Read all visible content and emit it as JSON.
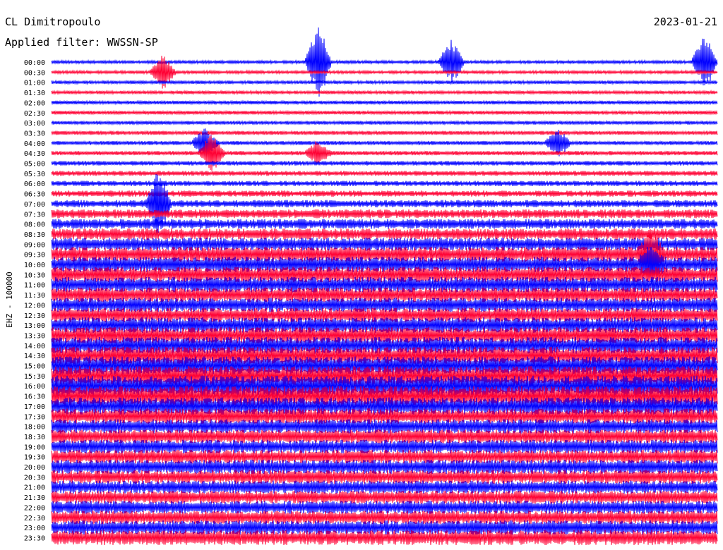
{
  "header": {
    "station": "CL Dimitropoulo",
    "filter": "Applied filter: WWSSN-SP",
    "date": "2023-01-21",
    "channel_label": "EHZ - 100000"
  },
  "chart_data": {
    "type": "line",
    "title": "CL Dimitropoulo",
    "subtitle": "Applied filter: WWSSN-SP",
    "date": "2023-01-21",
    "ylabel": "EHZ - 100000",
    "row_labels": [
      "00:00",
      "00:30",
      "01:00",
      "01:30",
      "02:00",
      "02:30",
      "03:00",
      "03:30",
      "04:00",
      "04:30",
      "05:00",
      "05:30",
      "06:00",
      "06:30",
      "07:00",
      "07:30",
      "08:00",
      "08:30",
      "09:00",
      "09:30",
      "10:00",
      "10:30",
      "11:00",
      "11:30",
      "12:00",
      "12:30",
      "13:00",
      "13:30",
      "14:00",
      "14:30",
      "15:00",
      "15:30",
      "16:00",
      "16:30",
      "17:00",
      "17:30",
      "18:00",
      "18:30",
      "19:00",
      "19:30",
      "20:00",
      "20:30",
      "21:00",
      "21:30",
      "22:00",
      "22:30",
      "23:00",
      "23:30"
    ],
    "row_amplitude": [
      0.1,
      0.1,
      0.11,
      0.11,
      0.12,
      0.12,
      0.12,
      0.13,
      0.13,
      0.14,
      0.15,
      0.16,
      0.17,
      0.2,
      0.24,
      0.28,
      0.32,
      0.36,
      0.42,
      0.48,
      0.5,
      0.5,
      0.5,
      0.48,
      0.46,
      0.46,
      0.5,
      0.52,
      0.54,
      0.56,
      0.6,
      0.62,
      0.66,
      0.64,
      0.56,
      0.5,
      0.46,
      0.44,
      0.44,
      0.44,
      0.46,
      0.44,
      0.42,
      0.42,
      0.42,
      0.44,
      0.46,
      0.48
    ],
    "colors": {
      "even": "#0000ff",
      "odd": "#ff0033"
    },
    "events": [
      {
        "row": 0,
        "time": 0.4,
        "amplitude": 5.5
      },
      {
        "row": 1,
        "time": 0.167,
        "amplitude": 2.2
      },
      {
        "row": 0,
        "time": 0.6,
        "amplitude": 3.0
      },
      {
        "row": 0,
        "time": 0.98,
        "amplitude": 4.0
      },
      {
        "row": 9,
        "time": 0.24,
        "amplitude": 2.5
      },
      {
        "row": 14,
        "time": 0.16,
        "amplitude": 4.5
      },
      {
        "row": 19,
        "time": 0.9,
        "amplitude": 3.0
      },
      {
        "row": 20,
        "time": 0.9,
        "amplitude": 2.0
      },
      {
        "row": 8,
        "time": 0.23,
        "amplitude": 2.0
      },
      {
        "row": 8,
        "time": 0.76,
        "amplitude": 1.8
      },
      {
        "row": 9,
        "time": 0.4,
        "amplitude": 1.5
      }
    ],
    "legend": "none",
    "grid": false
  }
}
